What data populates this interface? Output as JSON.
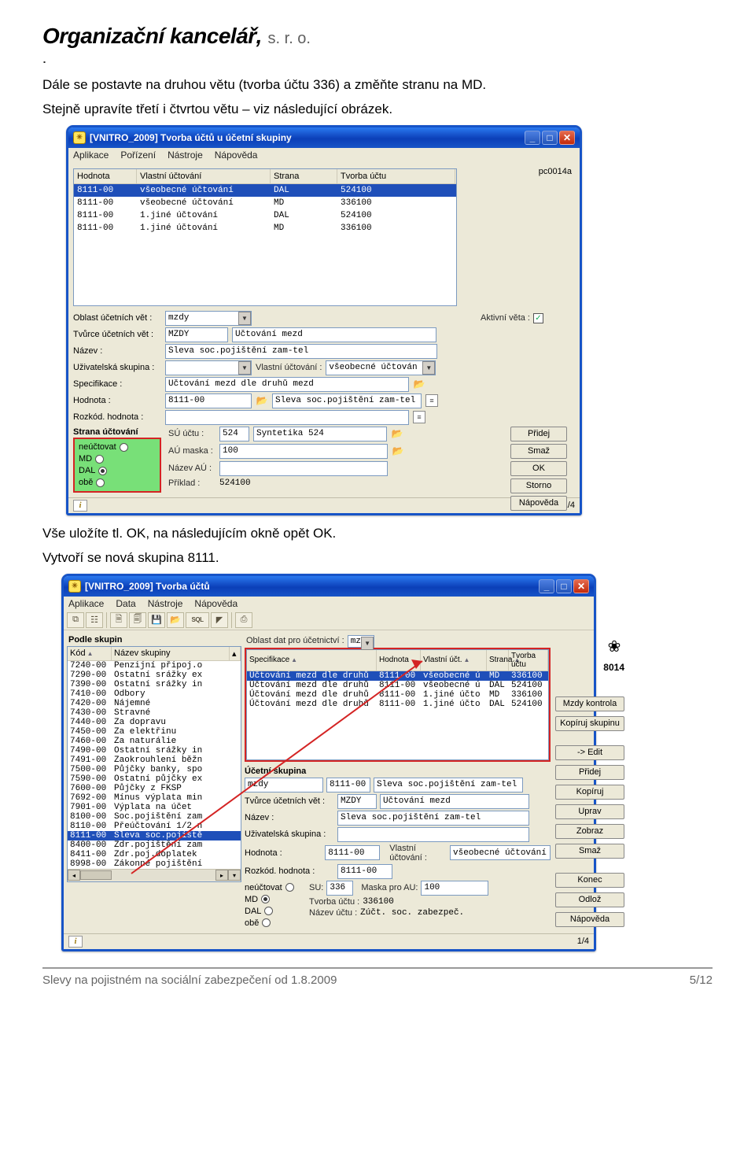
{
  "header": {
    "logo_main": "Organizační kancelář,",
    "logo_suffix": " s. r. o."
  },
  "intro": {
    "p1": "Dále se postavte na druhou větu (tvorba účtu 336) a změňte stranu na MD.",
    "p2": "Stejně upravíte třetí i čtvrtou větu – viz následující obrázek."
  },
  "mid_text": {
    "l1": "Vše uložíte tl. OK, na následujícím okně opět OK.",
    "l2": "Vytvoří se nová skupina 8111."
  },
  "footer": {
    "left": "Slevy na pojistném na sociální zabezpečení od 1.8.2009",
    "right": "5/12"
  },
  "win1": {
    "title": "[VNITRO_2009] Tvorba účtů u účetní skupiny",
    "menu": [
      "Aplikace",
      "Pořízení",
      "Nástroje",
      "Nápověda"
    ],
    "pc": "pc0014a",
    "table": {
      "headers": [
        "Hodnota",
        "Vlastní účtování",
        "Strana",
        "Tvorba účtu"
      ],
      "rows": [
        {
          "h": "8111-00",
          "v": "všeobecné účtování",
          "s": "DAL",
          "t": "524100",
          "sel": true
        },
        {
          "h": "8111-00",
          "v": "všeobecné účtování",
          "s": "MD",
          "t": "336100"
        },
        {
          "h": "8111-00",
          "v": "1.jiné účtování",
          "s": "DAL",
          "t": "524100"
        },
        {
          "h": "8111-00",
          "v": "1.jiné účtování",
          "s": "MD",
          "t": "336100"
        }
      ]
    },
    "form": {
      "oblast_lab": "Oblast účetních vět :",
      "oblast_val": "mzdy",
      "active_lab": "Aktivní věta :",
      "active_chk": "✓",
      "tvurce_lab": "Tvůrce účetních vět :",
      "tvurce_code": "MZDY",
      "tvurce_desc": "Účtování mezd",
      "nazev_lab": "Název :",
      "nazev_val": "Sleva soc.pojištění zam-tel",
      "usk_lab": "Uživatelská skupina :",
      "usk_val": "",
      "vlast_lab": "Vlastní účtování :",
      "vlast_val": "všeobecné účtován",
      "spec_lab": "Specifikace :",
      "spec_val": "Účtování mezd dle druhů mezd",
      "hod_lab": "Hodnota :",
      "hod_val": "8111-00",
      "hod_desc": "Sleva soc.pojištění zam-tel",
      "rozk_lab": "Rozkód. hodnota :",
      "rozk_val": "",
      "group_title": "Strana účtování",
      "radios": {
        "neuct": "neúčtovat",
        "md": "MD",
        "dal": "DAL",
        "obe": "obě",
        "selected": "dal"
      },
      "su_lab": "SÚ účtu :",
      "su_val": "524",
      "su_desc": "Syntetika 524",
      "au_lab": "AÚ maska :",
      "au_val": "100",
      "nazevau_lab": "Název AÚ :",
      "nazevau_val": "",
      "priklad_lab": "Příklad :",
      "priklad_val": "524100",
      "buttons": [
        "Přidej",
        "Smaž",
        "OK",
        "Storno",
        "Nápověda"
      ]
    },
    "status": "1/4"
  },
  "win2": {
    "title": "[VNITRO_2009] Tvorba účtů",
    "menu": [
      "Aplikace",
      "Data",
      "Nástroje",
      "Nápověda"
    ],
    "toolbar_icons": [
      "navig",
      "hier",
      "doc",
      "dbl",
      "disk",
      "open",
      "sql",
      "notch",
      "print"
    ],
    "left": {
      "title": "Podle skupin",
      "headers": [
        "Kód",
        "Název skupiny"
      ],
      "rows": [
        [
          "7240-00",
          "Penzijní připoj.o"
        ],
        [
          "7290-00",
          "Ostatní srážky ex"
        ],
        [
          "7390-00",
          "Ostatní srážky in"
        ],
        [
          "7410-00",
          "Odbory"
        ],
        [
          "7420-00",
          "Nájemné"
        ],
        [
          "7430-00",
          "Stravné"
        ],
        [
          "7440-00",
          "Za dopravu"
        ],
        [
          "7450-00",
          "Za elektřinu"
        ],
        [
          "7460-00",
          "Za naturálie"
        ],
        [
          "7490-00",
          "Ostatní srážky in"
        ],
        [
          "7491-00",
          "Zaokrouhlení běžn"
        ],
        [
          "7500-00",
          "Půjčky banky, spo"
        ],
        [
          "7590-00",
          "Ostatní půjčky ex"
        ],
        [
          "7600-00",
          "Půjčky z FKSP"
        ],
        [
          "7692-00",
          "Mínus výplata min"
        ],
        [
          "7901-00",
          "Výplata na účet"
        ],
        [
          "8100-00",
          "Soc.pojištění zam"
        ],
        [
          "8110-00",
          "Přeúčtování 1/2 n"
        ],
        [
          "8111-00",
          "Sleva soc.pojiště"
        ],
        [
          "8400-00",
          "Zdr.pojištění zam"
        ],
        [
          "8411-00",
          "Zdr.poj.doplatek"
        ],
        [
          "8998-00",
          "Zákonné pojištění"
        ]
      ],
      "selected_index": 18
    },
    "mid": {
      "oblast_lab": "Oblast dat pro účetnictví :",
      "oblast_val": "mzdy",
      "headers": [
        "Specifikace",
        "Hodnota",
        "Vlastní účt.",
        "Strana",
        "Tvorba účtu"
      ],
      "rows": [
        {
          "s": "Účtování mezd dle druhů",
          "h": "8111-00",
          "v": "všeobecné ú",
          "st": "MD",
          "t": "336100",
          "sel": true
        },
        {
          "s": "Účtování mezd dle druhů",
          "h": "8111-00",
          "v": "všeobecné ú",
          "st": "DAL",
          "t": "524100"
        },
        {
          "s": "Účtování mezd dle druhů",
          "h": "8111-00",
          "v": "1.jiné účto",
          "st": "MD",
          "t": "336100"
        },
        {
          "s": "Účtování mezd dle druhů",
          "h": "8111-00",
          "v": "1.jiné účto",
          "st": "DAL",
          "t": "524100"
        }
      ],
      "group_title": "Účetní skupina",
      "g_left": "mzdy",
      "g_code": "8111-00",
      "g_desc": "Sleva soc.pojištění zam-tel",
      "tvurce_lab": "Tvůrce účetních vět :",
      "tvurce_code": "MZDY",
      "tvurce_desc": "Účtování mezd",
      "nazev_lab": "Název :",
      "nazev_val": "Sleva soc.pojištění zam-tel",
      "usk_lab": "Uživatelská skupina :",
      "usk_val": "",
      "vlast_lab": "Vlastní účtování :",
      "vlast_val": "všeobecné účtování",
      "hod_lab": "Hodnota :",
      "hod_val": "8111-00",
      "rozk_lab": "Rozkód. hodnota :",
      "rozk_val": "8111-00",
      "radios": {
        "neuct": "neúčtovat",
        "md": "MD",
        "dal": "DAL",
        "obe": "obě",
        "selected": "md"
      },
      "su_lab": "SU:",
      "su_val": "336",
      "mask_lab": "Maska pro AU:",
      "mask_val": "100",
      "tvorba_lab": "Tvorba účtu :",
      "tvorba_val": "336100",
      "nazevuc_lab": "Název účtu :",
      "nazevuc_val": "Zúčt. soc. zabezpeč."
    },
    "right": {
      "code": "8014",
      "btns1": [
        "Mzdy kontrola",
        "Kopíruj skupinu"
      ],
      "btns2": [
        "-> Edit",
        "Přidej",
        "Kopíruj",
        "Uprav",
        "Zobraz",
        "Smaž"
      ],
      "btns3": [
        "Konec",
        "Odlož",
        "Nápověda"
      ]
    },
    "status": "1/4"
  }
}
